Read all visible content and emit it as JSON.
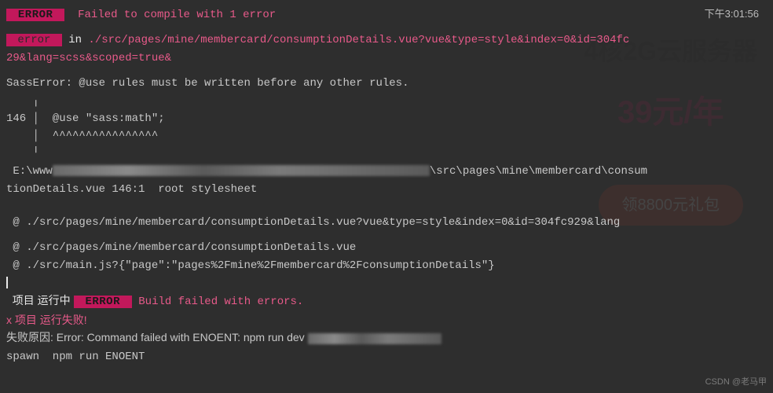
{
  "timestamp": "下午3:01:56",
  "topError": {
    "badge": " ERROR ",
    "message": "Failed to compile with 1 error"
  },
  "errorIn": {
    "badge": " error ",
    "prefix": " in ",
    "path": "./src/pages/mine/membercard/consumptionDetails.vue?vue&type=style&index=0&id=304fc",
    "pathCont": "29&lang=scss&scoped=true&"
  },
  "sass": {
    "header": "SassError: @use rules must be written before any other rules.",
    "boxTop": "    ╷",
    "boxLine": "146 │  @use \"sass:math\";",
    "boxCaret": "    │  ^^^^^^^^^^^^^^^^",
    "boxBottom": "    ╵",
    "filePrefix": " E:\\www",
    "fileSuffix": "\\src\\pages\\mine\\membercard\\consum",
    "fileLine2": "tionDetails.vue 146:1  root stylesheet"
  },
  "stack": {
    "l1": " @ ./src/pages/mine/membercard/consumptionDetails.vue?vue&type=style&index=0&id=304fc929&lang",
    "l2": " @ ./src/pages/mine/membercard/consumptionDetails.vue",
    "l3": " @ ./src/main.js?{\"page\":\"pages%2Fmine%2Fmembercard%2FconsumptionDetails\"}"
  },
  "build": {
    "running": "  项目 运行中 ",
    "badge": " ERROR ",
    "msg": " Build failed with errors.",
    "failed": "x 项目 运行失败!",
    "reasonPrefix": "失败原因: Error: Command failed with ENOENT: npm run dev ",
    "spawn": "spawn  npm run ENOENT"
  },
  "ad": {
    "title": "4核2G云服务器",
    "price": "39元/年",
    "btn": "领8800元礼包"
  },
  "watermark": "CSDN @老马甲"
}
